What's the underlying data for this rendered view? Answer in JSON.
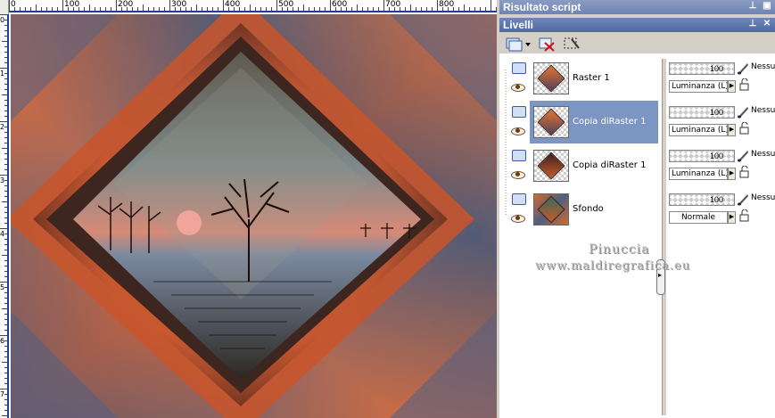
{
  "ruler": {
    "top_labels": [
      "0",
      "100",
      "200",
      "300",
      "400",
      "500",
      "600",
      "700",
      "800"
    ],
    "left_labels": [
      "0",
      "100",
      "200",
      "300",
      "400",
      "500",
      "600",
      "700"
    ]
  },
  "panels": {
    "script_title": "Risultato script",
    "layers_title": "Livelli"
  },
  "layers": [
    {
      "name": "Raster 1",
      "opacity": "100",
      "mode_label": "Nessu",
      "blend": "Luminanza (L)",
      "selected": false
    },
    {
      "name": "Copia diRaster 1",
      "opacity": "100",
      "mode_label": "Nessu",
      "blend": "Luminanza (L)",
      "selected": true
    },
    {
      "name": "Copia diRaster 1",
      "opacity": "100",
      "mode_label": "Nessu",
      "blend": "Luminanza (L)",
      "selected": false
    },
    {
      "name": "Sfondo",
      "opacity": "100",
      "mode_label": "Nessu",
      "blend": "Normale",
      "selected": false
    }
  ],
  "watermark": {
    "line1": "Pinuccia",
    "line2": "www.maldiregrafica.eu"
  },
  "colors": {
    "title_bar": "#5a74ab",
    "selected_layer": "#7b96c3",
    "accent_orange": "#d6602a",
    "accent_slate": "#5b6179"
  }
}
